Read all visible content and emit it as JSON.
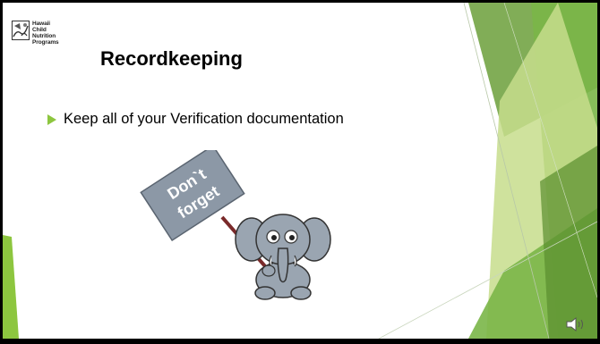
{
  "logo": {
    "lines": [
      "Hawaii",
      "Child",
      "Nutrition",
      "Programs"
    ]
  },
  "slide": {
    "title": "Recordkeeping",
    "bullets": [
      "Keep all of your Verification documentation"
    ]
  },
  "illustration": {
    "sign_text": [
      "Don`t",
      "forget"
    ]
  },
  "colors": {
    "accent_green": "#7ab648",
    "light_green": "#c7dd8c",
    "dark_green": "#5a8f2e",
    "bullet_green": "#8dc63f",
    "elephant_gray": "#9aa5b1",
    "sign_gray": "#8c98a6"
  },
  "icons": {
    "bullet": "triangle-bullet-icon",
    "audio": "speaker-icon",
    "logo": "logo-emblem-icon"
  }
}
